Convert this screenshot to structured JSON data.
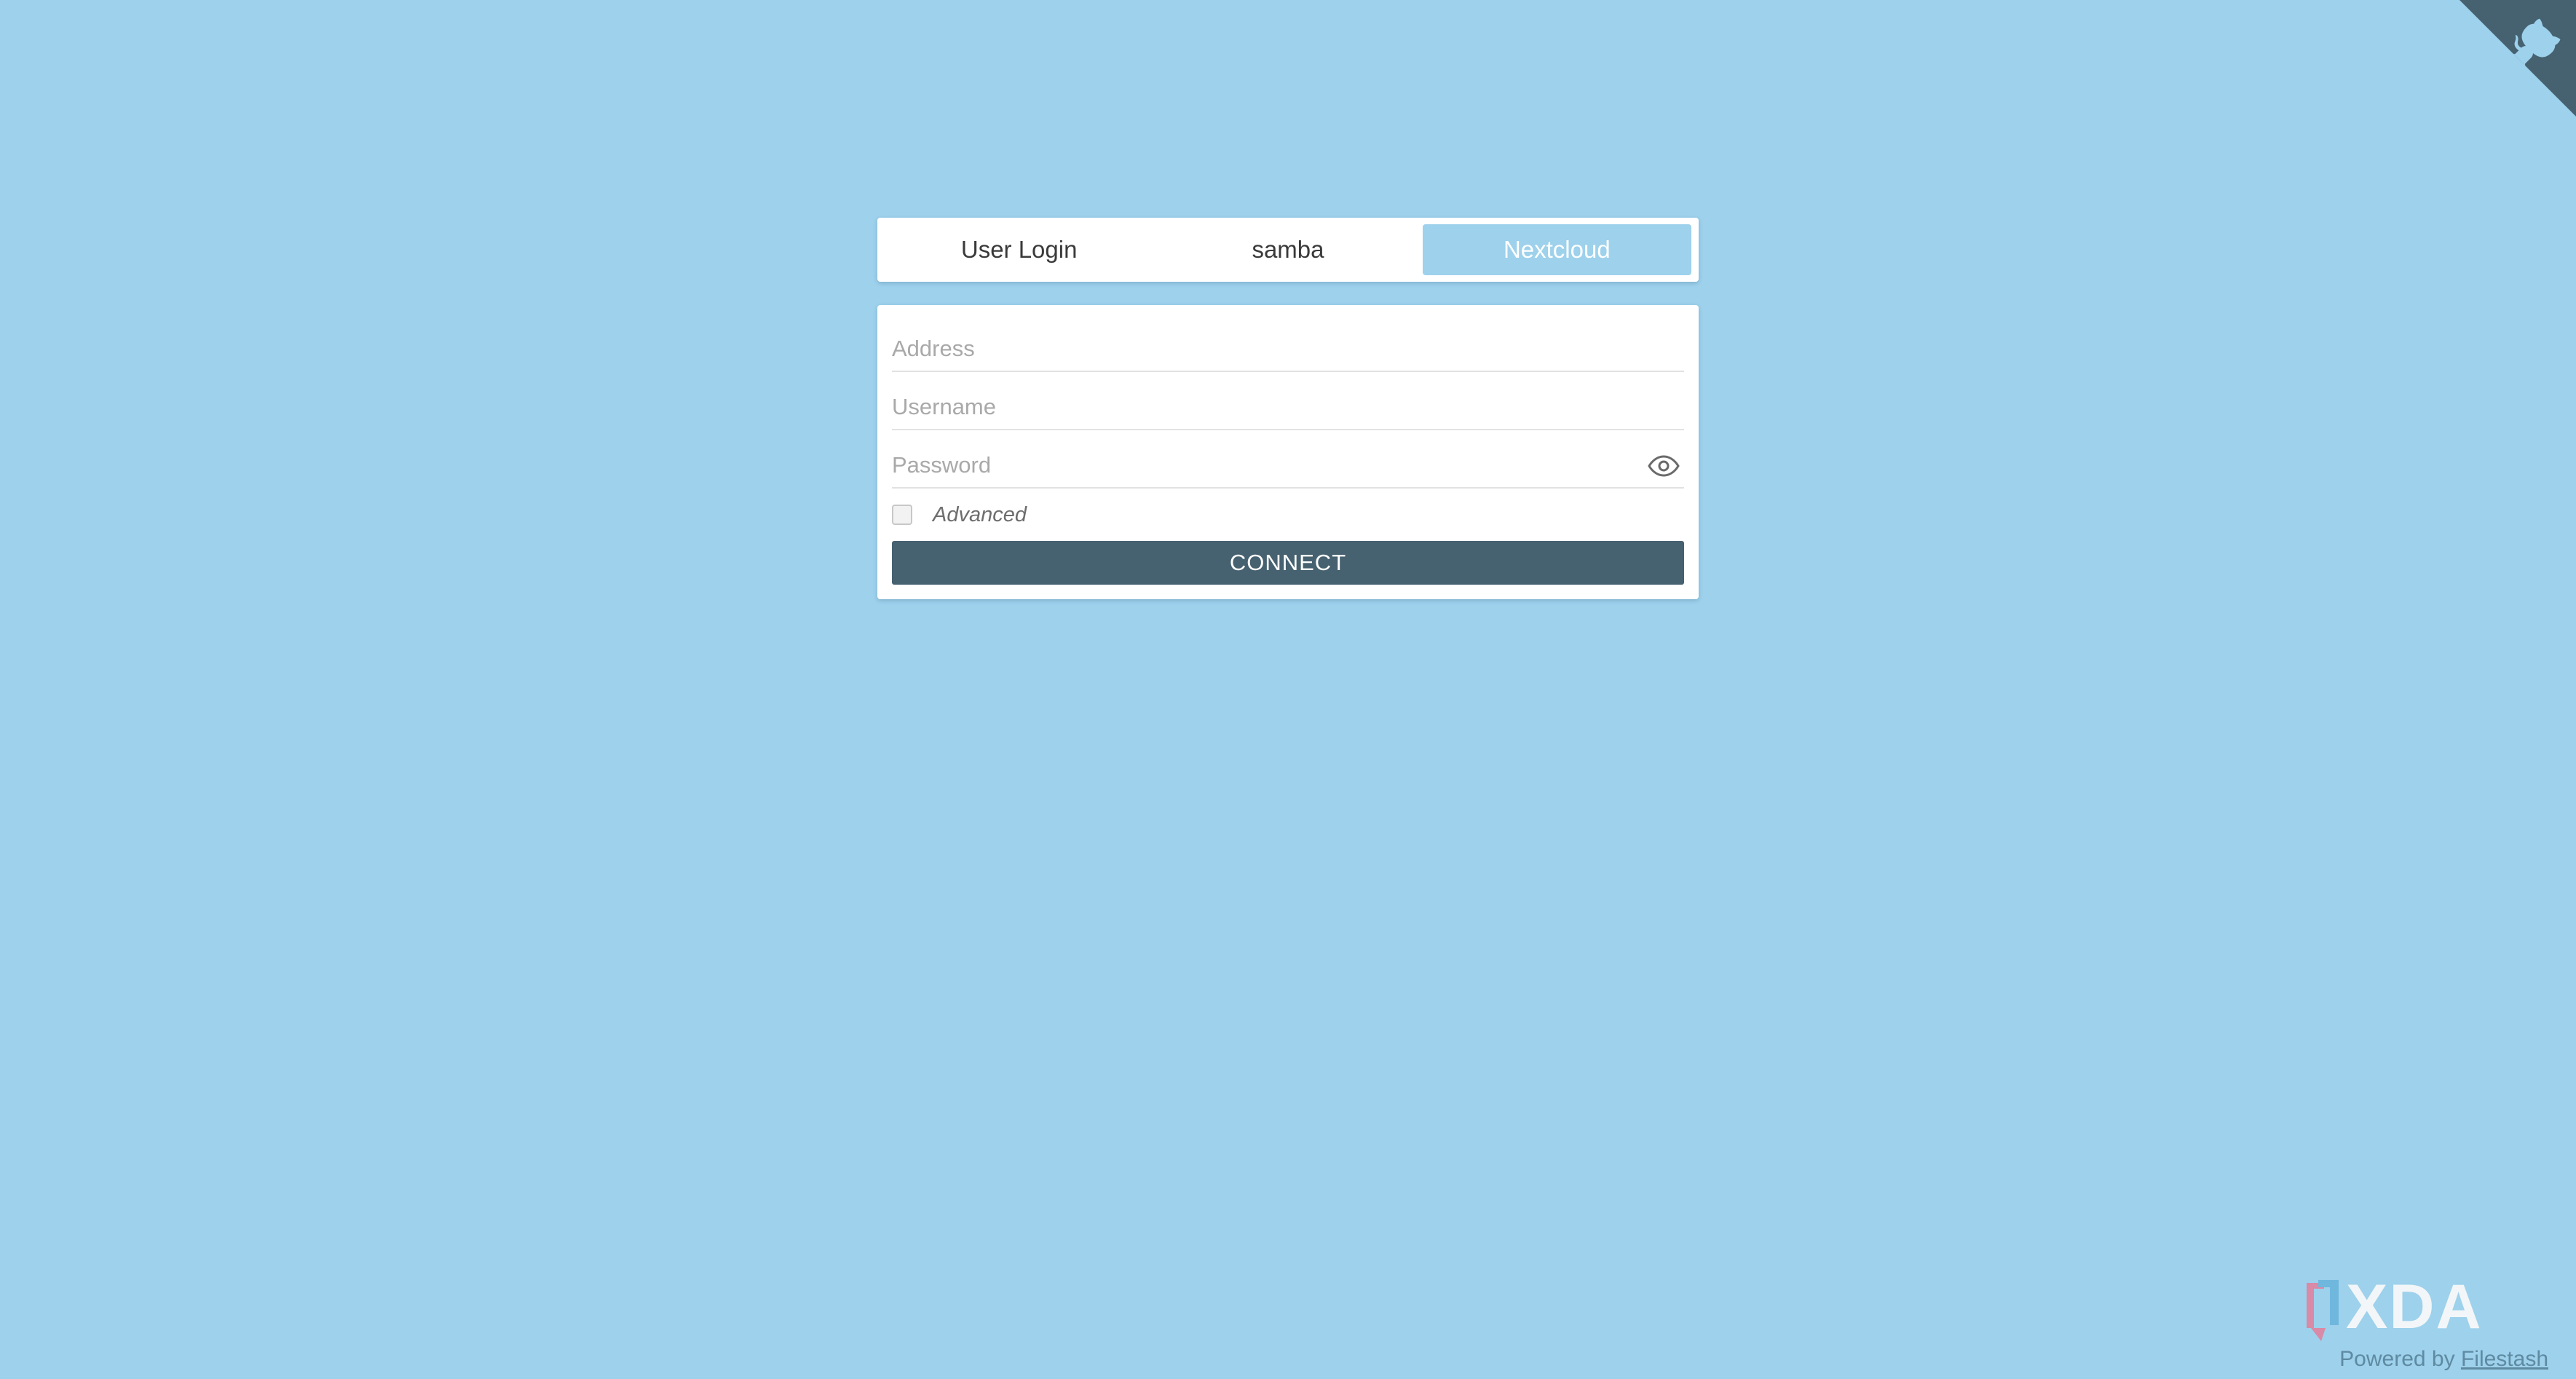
{
  "tabs": [
    {
      "label": "User Login",
      "active": false
    },
    {
      "label": "samba",
      "active": false
    },
    {
      "label": "Nextcloud",
      "active": true
    }
  ],
  "form": {
    "address": {
      "placeholder": "Address",
      "value": ""
    },
    "username": {
      "placeholder": "Username",
      "value": ""
    },
    "password": {
      "placeholder": "Password",
      "value": ""
    },
    "advanced_label": "Advanced",
    "advanced_checked": false,
    "connect_label": "CONNECT"
  },
  "footer": {
    "powered_by": "Powered by",
    "link_text": "Filestash"
  },
  "watermark": {
    "logo_text": "XDA"
  },
  "colors": {
    "background": "#9dd1ec",
    "active_tab": "#9dd1ec",
    "button": "#466170",
    "corner": "#466170"
  },
  "icons": {
    "corner": "github-icon",
    "password_toggle": "eye-icon"
  }
}
